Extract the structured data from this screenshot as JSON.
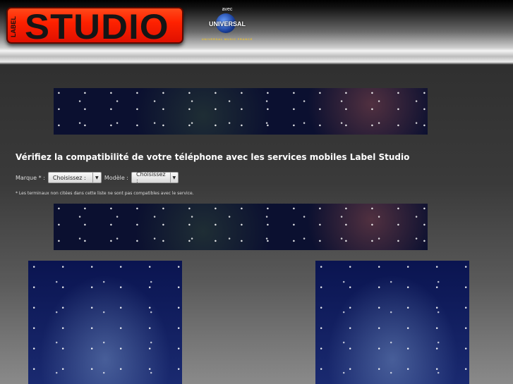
{
  "header": {
    "logo_small": "LABEL",
    "logo_main": "STUDIO",
    "partner_prefix": "avec",
    "partner_name": "UNIVERSAL",
    "partner_sub": "UNIVERSAL MUSIC FRANCE"
  },
  "main": {
    "title": "Vérifiez la compatibilité de votre téléphone avec les services mobiles Label Studio",
    "marque_label": "Marque * :",
    "marque_value": "Choisissez :",
    "modele_label": "Modèle :",
    "modele_value": "Choisissez :",
    "note": "* Les terminaux non citées dans cette liste ne sont pas compatibles avec le service."
  },
  "icons": {
    "dropdown": "▼"
  }
}
